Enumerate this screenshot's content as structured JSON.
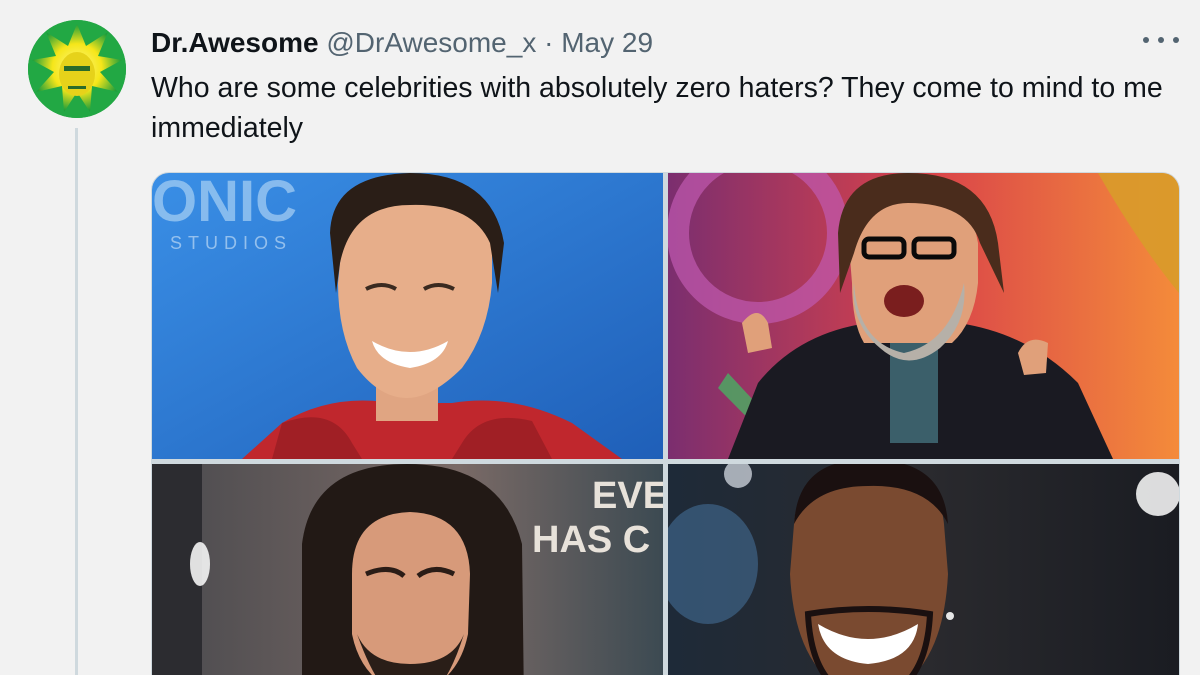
{
  "tweet": {
    "display_name": "Dr.Awesome",
    "handle": "@DrAwesome_x",
    "separator": "·",
    "date": "May 29",
    "text": "Who are some celebrities with absolutely zero haters? They come to mind to me immediately",
    "more_icon": "more-horizontal-icon"
  },
  "media": {
    "photos": [
      {
        "subject": "photo-1",
        "backdrop_text": "ONIC"
      },
      {
        "subject": "photo-2"
      },
      {
        "subject": "photo-3",
        "backdrop_text_1": "EVE",
        "backdrop_text_2": "HAS C"
      },
      {
        "subject": "photo-4"
      }
    ]
  },
  "colors": {
    "background": "#f2f2f2",
    "text_primary": "#0f1419",
    "text_secondary": "#536471",
    "border": "#cfd9de",
    "avatar_green": "#1f9e3a",
    "avatar_yellow": "#f5e619"
  }
}
